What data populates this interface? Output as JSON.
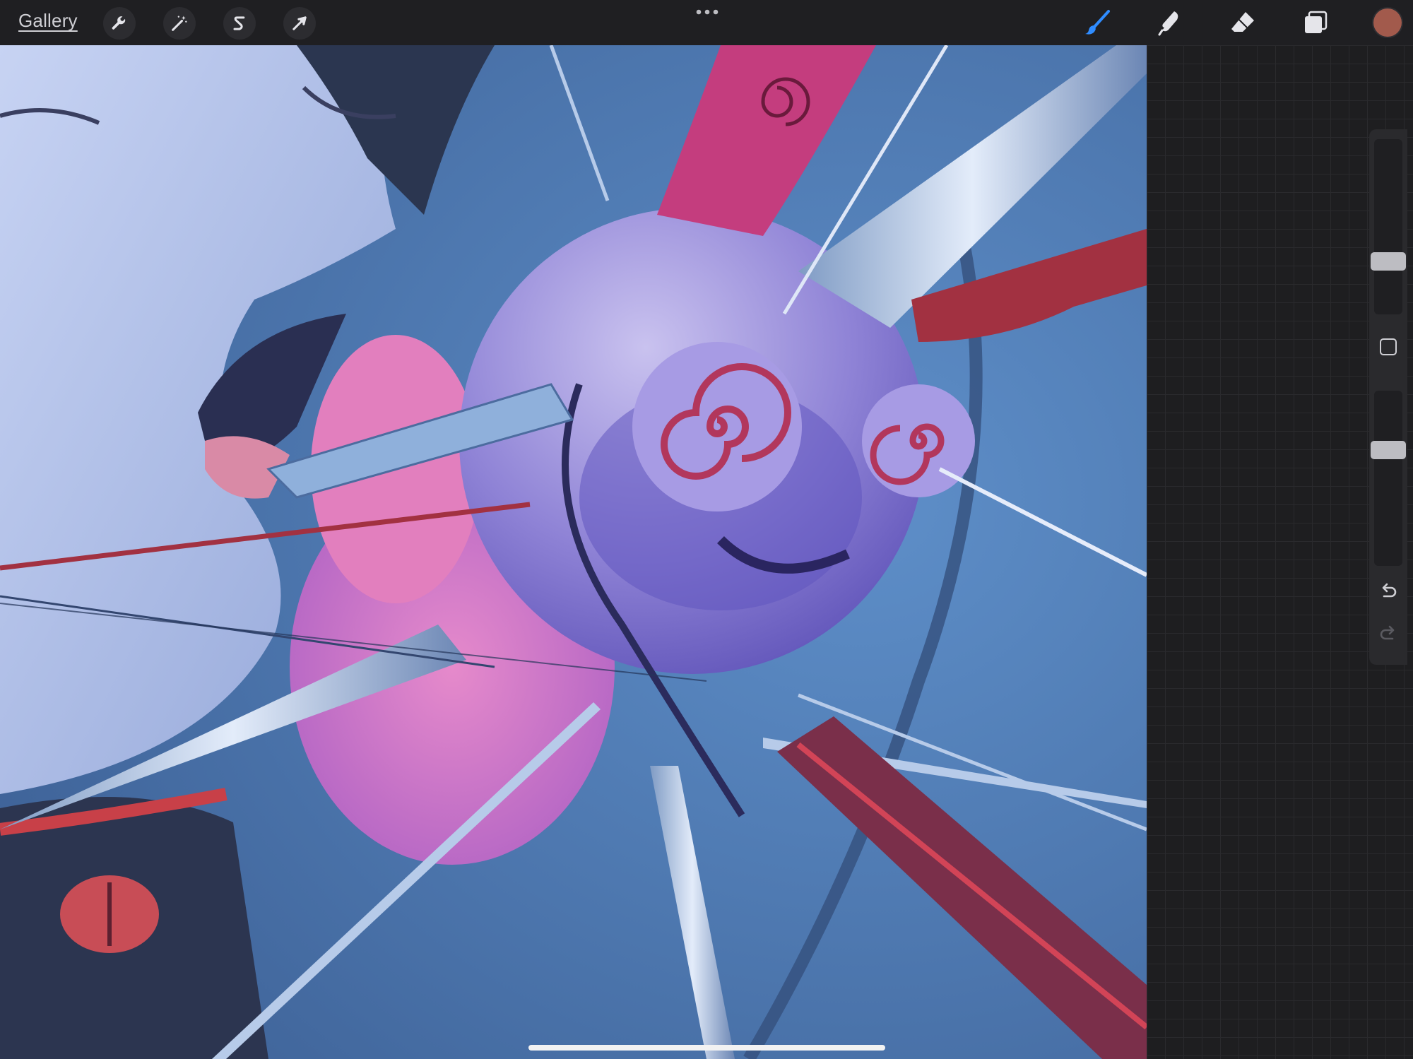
{
  "app": {
    "gallery_label": "Gallery"
  },
  "toolbar": {
    "left_tools": [
      {
        "name": "actions",
        "icon": "wrench-icon"
      },
      {
        "name": "adjustments",
        "icon": "magic-wand-icon"
      },
      {
        "name": "selection",
        "icon": "selection-s-icon"
      },
      {
        "name": "transform",
        "icon": "arrow-cursor-icon"
      }
    ],
    "more_icon": "more-dots-icon",
    "right_tools": [
      {
        "name": "brush",
        "icon": "brush-icon",
        "active": true,
        "color": "#2f8cff"
      },
      {
        "name": "smudge",
        "icon": "smudge-icon",
        "active": false
      },
      {
        "name": "eraser",
        "icon": "eraser-icon",
        "active": false
      },
      {
        "name": "layers",
        "icon": "layers-icon",
        "active": false
      }
    ],
    "current_color": "#a25a4c"
  },
  "sidebar": {
    "brush_size_level": 0.28,
    "opacity_level": 0.68,
    "modify_icon": "square-modify-icon",
    "undo_icon": "undo-icon",
    "redo_icon": "redo-icon"
  },
  "colors": {
    "accent": "#2f8cff",
    "toolbar_bg": "#1f1f22"
  }
}
